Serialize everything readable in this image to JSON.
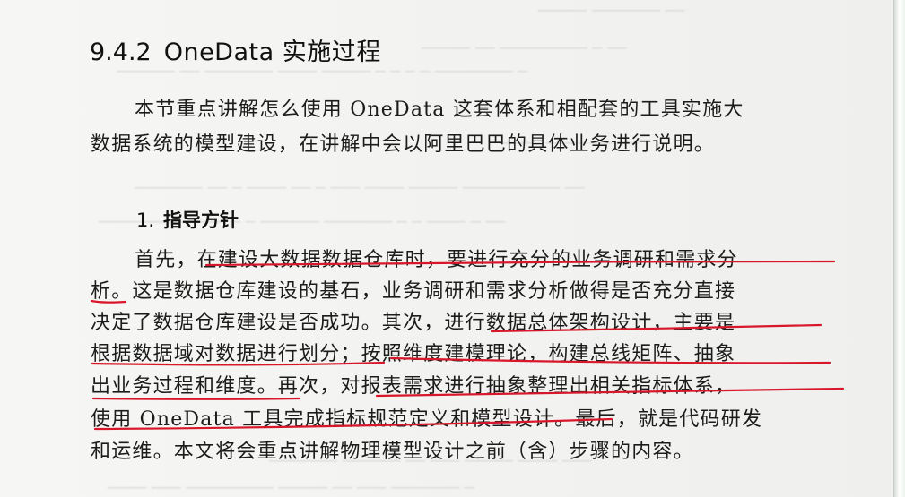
{
  "section": {
    "number": "9.4.2",
    "title": "OneData 实施过程"
  },
  "intro_lines": [
    "本节重点讲解怎么使用 OneData 这套体系和相配套的工具实施大",
    "数据系统的模型建设，在讲解中会以阿里巴巴的具体业务进行说明。"
  ],
  "subsection": {
    "index": "1.",
    "title": "指导方针"
  },
  "body_lines": [
    "首先，在建设大数据数据仓库时，要进行充分的业务调研和需求分",
    "析。这是数据仓库建设的基石，业务调研和需求分析做得是否充分直接",
    "决定了数据仓库建设是否成功。其次，进行数据总体架构设计，主要是",
    "根据数据域对数据进行划分；按照维度建模理论，构建总线矩阵、抽象",
    "出业务过程和维度。再次，对报表需求进行抽象整理出相关指标体系，",
    "使用 OneData 工具完成指标规范定义和模型设计。最后，就是代码研发",
    "和运维。本文将会重点讲解物理模型设计之前（含）步骤的内容。"
  ],
  "annotation": {
    "color": "#d8182a",
    "type": "handwritten-red-underline"
  }
}
